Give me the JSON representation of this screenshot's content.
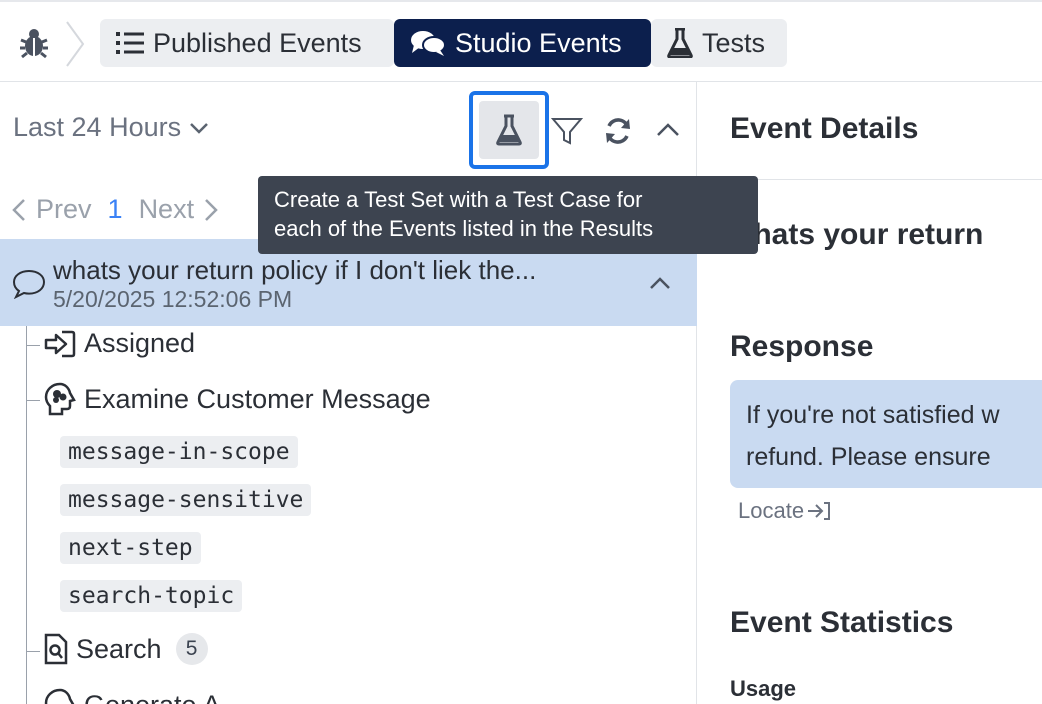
{
  "topbar": {
    "home_icon": "bug-icon",
    "tabs": [
      {
        "label": "Published Events",
        "icon": "list-icon",
        "active": false
      },
      {
        "label": "Studio Events",
        "icon": "chat-bubbles-icon",
        "active": true
      },
      {
        "label": "Tests",
        "icon": "flask-icon",
        "active": false
      }
    ]
  },
  "left": {
    "time_range": "Last 24 Hours",
    "pager": {
      "prev": "Prev",
      "page": "1",
      "next": "Next"
    },
    "event": {
      "title": "whats your return policy if I don't liek the...",
      "date": "5/20/2025 12:52:06 PM"
    },
    "tree": {
      "assigned": "Assigned",
      "examine": "Examine Customer Message",
      "tags": [
        "message-in-scope",
        "message-sensitive",
        "next-step",
        "search-topic"
      ],
      "search": "Search",
      "search_count": "5",
      "partial": "Generate A..."
    }
  },
  "tooltip": {
    "line1": "Create a Test Set with a Test Case for",
    "line2": "each of the Events listed in the Results"
  },
  "right": {
    "title": "Event Details",
    "question": "whats your return",
    "response_heading": "Response",
    "response_line1": "If you're not satisfied w",
    "response_line2": "refund. Please ensure",
    "locate": "Locate",
    "stats_heading": "Event Statistics",
    "usage": "Usage"
  },
  "colors": {
    "active_tab": "#0c1f4d",
    "selected_row": "#c9daf1",
    "focus_ring": "#1a73e8",
    "tooltip_bg": "#3d4450"
  }
}
